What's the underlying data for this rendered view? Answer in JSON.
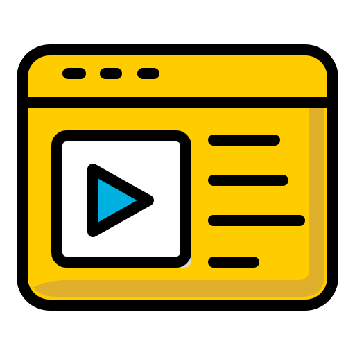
{
  "icon": {
    "name": "video-webpage-icon",
    "colors": {
      "outline": "#000000",
      "window_fill": "#FFCC00",
      "window_shade": "#E0B02C",
      "player_fill": "#FFFFFF",
      "player_shade": "#D9D9D9",
      "play_fill": "#00B0E0"
    },
    "window_dots": 3,
    "text_lines": 4
  }
}
